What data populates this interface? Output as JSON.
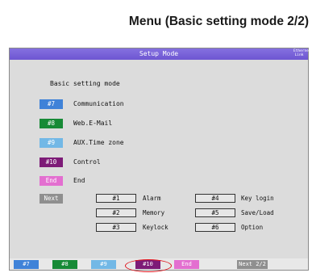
{
  "page_heading": "Menu (Basic setting mode 2/2)",
  "screen": {
    "title": "Setup Mode",
    "link_indicator": "Ethernet Link",
    "mode_label": "Basic setting mode"
  },
  "menu_items": [
    {
      "key": "#7",
      "label": "Communication",
      "color": "#3f82d8"
    },
    {
      "key": "#8",
      "label": "Web.E-Mail",
      "color": "#178a36"
    },
    {
      "key": "#9",
      "label": "AUX.Time zone",
      "color": "#72b8e6"
    },
    {
      "key": "#10",
      "label": "Control",
      "color": "#7d1b77"
    },
    {
      "key": "End",
      "label": "End",
      "color": "#e36fd0"
    }
  ],
  "next_button": {
    "key": "Next",
    "color": "#8f8f8f"
  },
  "sub_menus": [
    {
      "key": "#1",
      "label": "Alarm"
    },
    {
      "key": "#2",
      "label": "Memory"
    },
    {
      "key": "#3",
      "label": "Keylock"
    },
    {
      "key": "#4",
      "label": "Key login"
    },
    {
      "key": "#5",
      "label": "Save/Load"
    },
    {
      "key": "#6",
      "label": "Option"
    }
  ],
  "softkeys": [
    {
      "label": "#7",
      "color": "#3f82d8"
    },
    {
      "label": "#8",
      "color": "#178a36"
    },
    {
      "label": "#9",
      "color": "#72b8e6"
    },
    {
      "label": "#10",
      "color": "#7d1b77"
    },
    {
      "label": "End",
      "color": "#e36fd0"
    }
  ],
  "next_page_softkey": "Next 2/2",
  "accent_colors": {
    "titlebar": "#6d56d2",
    "highlight_ring": "#e0141c"
  }
}
